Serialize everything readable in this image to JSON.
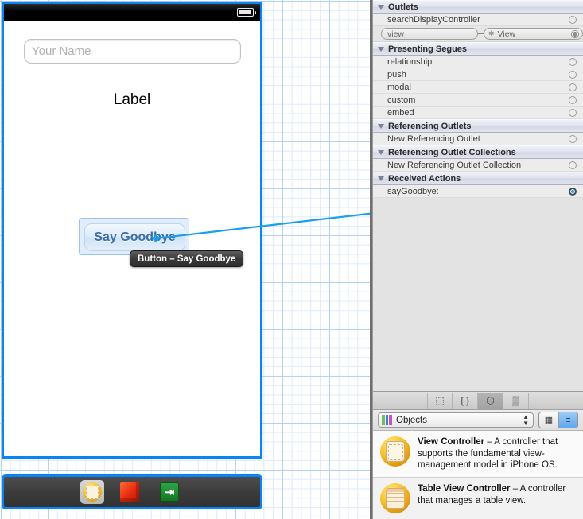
{
  "canvas": {
    "phone": {
      "status_bar": {
        "battery_icon": "battery-icon"
      },
      "text_field_placeholder": "Your Name",
      "label_text": "Label",
      "button_label": "Say Goodbye"
    },
    "tooltip": "Button – Say Goodbye",
    "dock": {
      "items": [
        {
          "name": "view-controller-icon",
          "label": "View Controller"
        },
        {
          "name": "first-responder-cube-icon",
          "label": "First Responder"
        },
        {
          "name": "exit-icon",
          "label": "Exit",
          "glyph": "⇥"
        }
      ]
    },
    "selection_color": "#0a84f5",
    "connection_color": "#19a0ec"
  },
  "inspector": {
    "sections": [
      {
        "title": "Outlets",
        "rows": [
          {
            "label": "searchDisplayController",
            "connected": false,
            "type": "plain"
          },
          {
            "label": "view",
            "connected": true,
            "type": "pill",
            "target": "View",
            "target_prefix": "✱"
          }
        ]
      },
      {
        "title": "Presenting Segues",
        "rows": [
          {
            "label": "relationship",
            "connected": false,
            "type": "plain"
          },
          {
            "label": "push",
            "connected": false,
            "type": "plain"
          },
          {
            "label": "modal",
            "connected": false,
            "type": "plain"
          },
          {
            "label": "custom",
            "connected": false,
            "type": "plain"
          },
          {
            "label": "embed",
            "connected": false,
            "type": "plain"
          }
        ]
      },
      {
        "title": "Referencing Outlets",
        "rows": [
          {
            "label": "New Referencing Outlet",
            "connected": false,
            "type": "plain"
          }
        ]
      },
      {
        "title": "Referencing Outlet Collections",
        "rows": [
          {
            "label": "New Referencing Outlet Collection",
            "connected": false,
            "type": "plain"
          }
        ]
      },
      {
        "title": "Received Actions",
        "rows": [
          {
            "label": "sayGoodbye:",
            "connected": true,
            "type": "plain"
          }
        ]
      }
    ]
  },
  "library": {
    "toolbar_icons": [
      {
        "name": "file-template-icon",
        "glyph": "⬚",
        "selected": false
      },
      {
        "name": "code-snippet-icon",
        "glyph": "{ }",
        "selected": false
      },
      {
        "name": "object-library-icon",
        "glyph": "⬡",
        "selected": true
      },
      {
        "name": "media-library-icon",
        "glyph": "▒",
        "selected": false
      }
    ],
    "picker_value": "Objects",
    "view_modes": [
      {
        "name": "grid-view-button",
        "glyph": "⊙",
        "selected": false
      },
      {
        "name": "list-view-button",
        "glyph": "≡",
        "selected": true
      }
    ],
    "items": [
      {
        "icon": "view-controller-library-icon",
        "title": "View Controller",
        "description": " – A controller that supports the fundamental view-management model in iPhone OS."
      },
      {
        "icon": "table-view-controller-library-icon",
        "title": "Table View Controller",
        "description": " – A controller that manages a table view."
      }
    ]
  }
}
